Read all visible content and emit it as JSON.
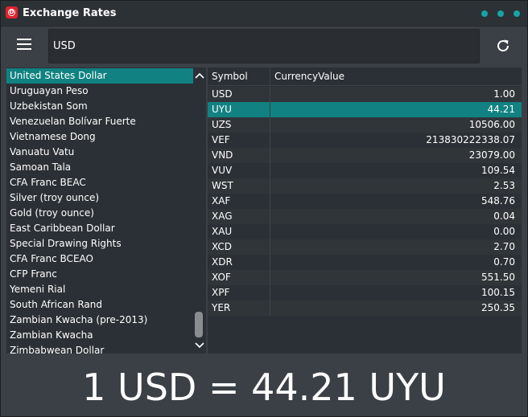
{
  "window": {
    "title": "Exchange Rates",
    "logo_letter": "D"
  },
  "search": {
    "value": "USD"
  },
  "icons": {
    "menu": "hamburger-menu-icon",
    "refresh": "refresh-icon",
    "scroll_up": "chevron-up-icon",
    "scroll_down": "chevron-down-icon"
  },
  "colors": {
    "accent": "#118181",
    "window_dots": "#17a3a3",
    "logo": "#e0232e"
  },
  "currency_list": {
    "selected_index": 0,
    "items": [
      "United States Dollar",
      "Uruguayan Peso",
      "Uzbekistan Som",
      "Venezuelan Bolívar Fuerte",
      "Vietnamese Dong",
      "Vanuatu Vatu",
      "Samoan Tala",
      "CFA Franc BEAC",
      "Silver (troy ounce)",
      "Gold (troy ounce)",
      "East Caribbean Dollar",
      "Special Drawing Rights",
      "CFA Franc BCEAO",
      "CFP Franc",
      "Yemeni Rial",
      "South African Rand",
      "Zambian Kwacha (pre-2013)",
      "Zambian Kwacha",
      "Zimbabwean Dollar"
    ]
  },
  "rates_table": {
    "headers": [
      "Symbol",
      "CurrencyValue"
    ],
    "selected_index": 1,
    "rows": [
      {
        "symbol": "USD",
        "value": "1.00"
      },
      {
        "symbol": "UYU",
        "value": "44.21"
      },
      {
        "symbol": "UZS",
        "value": "10506.00"
      },
      {
        "symbol": "VEF",
        "value": "213830222338.07"
      },
      {
        "symbol": "VND",
        "value": "23079.00"
      },
      {
        "symbol": "VUV",
        "value": "109.54"
      },
      {
        "symbol": "WST",
        "value": "2.53"
      },
      {
        "symbol": "XAF",
        "value": "548.76"
      },
      {
        "symbol": "XAG",
        "value": "0.04"
      },
      {
        "symbol": "XAU",
        "value": "0.00"
      },
      {
        "symbol": "XCD",
        "value": "2.70"
      },
      {
        "symbol": "XDR",
        "value": "0.70"
      },
      {
        "symbol": "XOF",
        "value": "551.50"
      },
      {
        "symbol": "XPF",
        "value": "100.15"
      },
      {
        "symbol": "YER",
        "value": "250.35"
      }
    ]
  },
  "result": {
    "text": "1 USD = 44.21 UYU"
  }
}
